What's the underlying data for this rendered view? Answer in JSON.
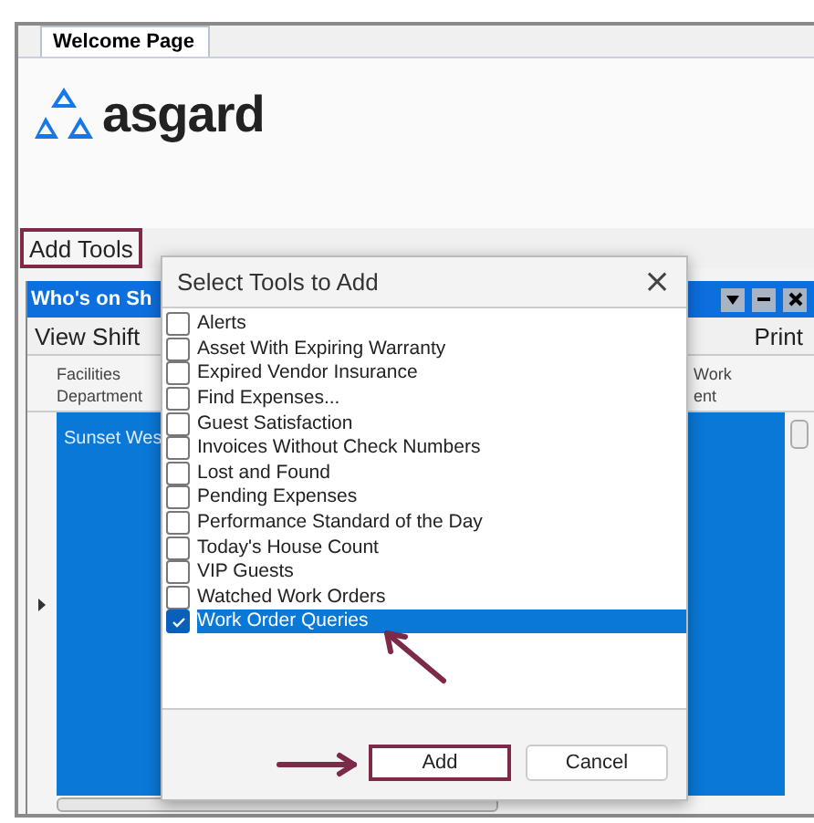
{
  "tabs": [
    {
      "label": "Welcome Page",
      "selected": true
    }
  ],
  "logo": {
    "text": "asgard"
  },
  "toolbar": {
    "label": "Add Tools",
    "highlighted": true
  },
  "panel": {
    "title": "Who's on Sh",
    "menu": [
      "View Shift",
      "Print"
    ],
    "columns": [
      {
        "lines": [
          "Facilities",
          "Department"
        ]
      },
      {
        "lines": [
          "Work",
          "ent"
        ]
      }
    ],
    "rows": [
      {
        "cell": "Sunset Wes",
        "selected": true
      }
    ]
  },
  "dialog": {
    "title": "Select Tools to Add",
    "close": "×",
    "items": [
      {
        "label": "Alerts",
        "checked": false,
        "selected": false
      },
      {
        "label": "Asset With Expiring Warranty",
        "checked": false,
        "selected": false
      },
      {
        "label": "Expired Vendor Insurance",
        "checked": false,
        "selected": false
      },
      {
        "label": "Find Expenses...",
        "checked": false,
        "selected": false
      },
      {
        "label": "Guest Satisfaction",
        "checked": false,
        "selected": false
      },
      {
        "label": "Invoices Without Check Numbers",
        "checked": false,
        "selected": false
      },
      {
        "label": "Lost and Found",
        "checked": false,
        "selected": false
      },
      {
        "label": "Pending Expenses",
        "checked": false,
        "selected": false
      },
      {
        "label": "Performance Standard of the Day",
        "checked": false,
        "selected": false
      },
      {
        "label": "Today's House Count",
        "checked": false,
        "selected": false
      },
      {
        "label": "VIP Guests",
        "checked": false,
        "selected": false
      },
      {
        "label": "Watched Work Orders",
        "checked": false,
        "selected": false
      },
      {
        "label": "Work Order Queries",
        "checked": true,
        "selected": true
      }
    ],
    "buttons": [
      {
        "label": "Add",
        "highlighted": true
      },
      {
        "label": "Cancel",
        "highlighted": false
      }
    ]
  }
}
